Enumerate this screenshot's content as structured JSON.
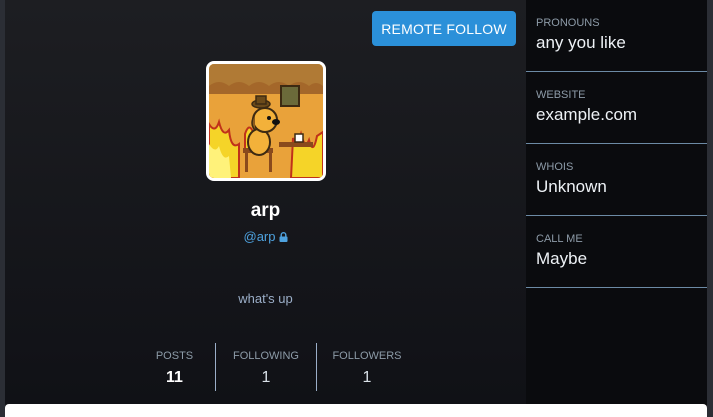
{
  "header": {
    "remote_follow_label": "REMOTE FOLLOW"
  },
  "profile": {
    "display_name": "arp",
    "username": "@arp",
    "bio": "what's up",
    "avatar_icon": "this-is-fine-dog-avatar"
  },
  "stats": [
    {
      "label": "POSTS",
      "value": "11"
    },
    {
      "label": "FOLLOWING",
      "value": "1"
    },
    {
      "label": "FOLLOWERS",
      "value": "1"
    }
  ],
  "fields": [
    {
      "name": "PRONOUNS",
      "value": "any you like"
    },
    {
      "name": "WEBSITE",
      "value": "example.com"
    },
    {
      "name": "WHOIS",
      "value": "Unknown"
    },
    {
      "name": "CALL ME",
      "value": "Maybe"
    }
  ],
  "colors": {
    "accent": "#2b90d9",
    "link": "#4ea2df",
    "background": "#18191d"
  }
}
